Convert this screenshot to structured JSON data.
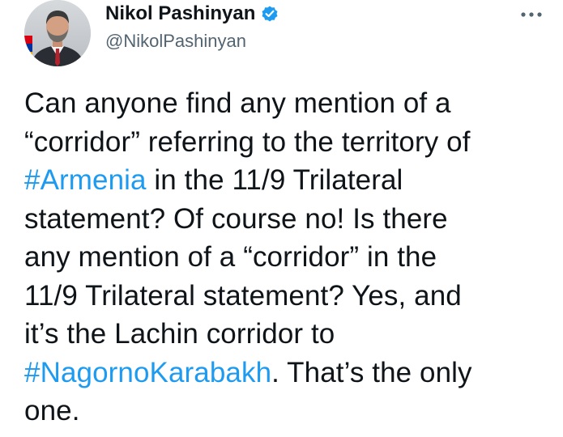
{
  "author": {
    "display_name": "Nikol Pashinyan",
    "handle": "@NikolPashinyan",
    "verified": true,
    "avatar_icon": "profile-photo"
  },
  "menu": {
    "icon": "more-icon"
  },
  "tweet": {
    "lines": [
      [
        {
          "text": "Can anyone find any mention of a"
        }
      ],
      [
        {
          "text": "“corridor” referring to the territory of"
        }
      ],
      [
        {
          "text": "#Armenia",
          "hashtag": true
        },
        {
          "text": " in the 11/9 Trilateral"
        }
      ],
      [
        {
          "text": "statement? Of course no! Is there"
        }
      ],
      [
        {
          "text": "any mention of a “corridor” in the"
        }
      ],
      [
        {
          "text": "11/9 Trilateral statement? Yes, and"
        }
      ],
      [
        {
          "text": "it’s the Lachin corridor to"
        }
      ],
      [
        {
          "text": "#NagornoKarabakh",
          "hashtag": true
        },
        {
          "text": ". That’s the only"
        }
      ],
      [
        {
          "text": "one."
        }
      ]
    ]
  },
  "colors": {
    "text": "#0f1419",
    "secondary": "#536471",
    "accent": "#1d9bf0"
  }
}
